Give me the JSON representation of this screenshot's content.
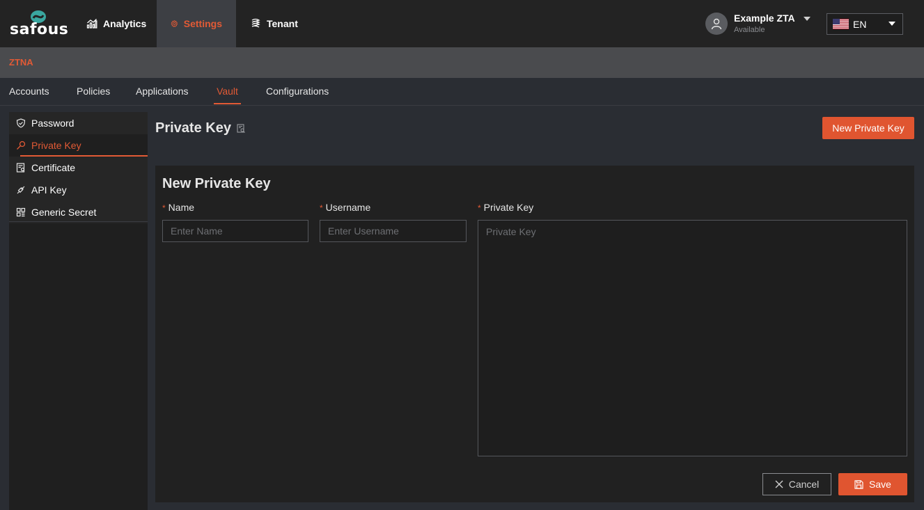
{
  "brand": {
    "logo_text": "safous",
    "accent_color": "#e25a35"
  },
  "topnav": {
    "items": [
      {
        "label": "Analytics",
        "icon": "bar-chart-icon"
      },
      {
        "label": "Settings",
        "icon": "gear-icon",
        "active": true
      },
      {
        "label": "Tenant",
        "icon": "tenant-icon"
      }
    ]
  },
  "user": {
    "name": "Example ZTA",
    "status": "Available"
  },
  "language": {
    "code": "EN",
    "flag": "us-flag-icon"
  },
  "subheader": {
    "title": "ZTNA"
  },
  "tabs": [
    {
      "label": "Accounts"
    },
    {
      "label": "Policies"
    },
    {
      "label": "Applications"
    },
    {
      "label": "Vault",
      "active": true
    },
    {
      "label": "Configurations"
    }
  ],
  "sidebar": {
    "items": [
      {
        "label": "Password",
        "icon": "shield-icon"
      },
      {
        "label": "Private Key",
        "icon": "key-icon",
        "active": true
      },
      {
        "label": "Certificate",
        "icon": "certificate-icon"
      },
      {
        "label": "API Key",
        "icon": "api-key-icon"
      },
      {
        "label": "Generic Secret",
        "icon": "grid-icon"
      }
    ]
  },
  "page": {
    "title": "Private Key",
    "new_button_label": "New Private Key"
  },
  "form": {
    "title": "New Private Key",
    "name": {
      "label": "Name",
      "placeholder": "Enter Name",
      "value": ""
    },
    "username": {
      "label": "Username",
      "placeholder": "Enter Username",
      "value": ""
    },
    "private_key": {
      "label": "Private Key",
      "placeholder": "Private Key",
      "value": ""
    },
    "cancel_label": "Cancel",
    "save_label": "Save"
  }
}
